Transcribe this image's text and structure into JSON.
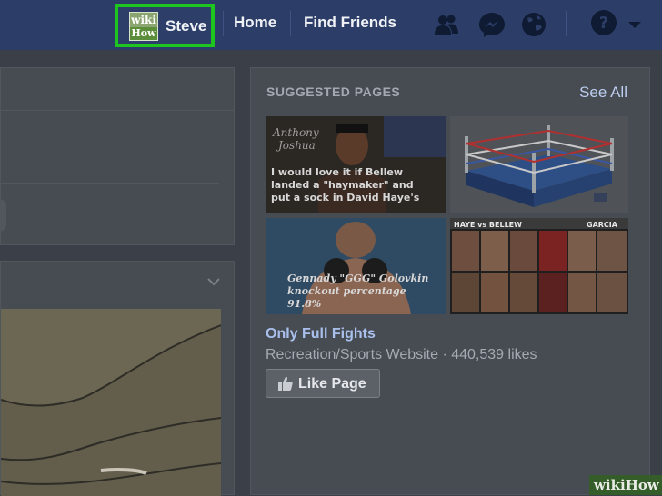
{
  "topbar": {
    "avatar_top": "wiki",
    "avatar_bottom": "How",
    "profile_name": "Steve",
    "home_label": "Home",
    "find_friends_label": "Find Friends"
  },
  "suggested": {
    "title": "SUGGESTED PAGES",
    "see_all": "See All",
    "thumb1_caption": "I would love it if Bellew landed a \"haymaker\" and put a sock in David Haye's",
    "thumb3_caption": "Gennady \"GGG\" Golovkin knockout percentage 91.8%",
    "page_name": "Only Full Fights",
    "page_meta": "Recreation/Sports Website · 440,539 likes",
    "like_label": "Like Page"
  },
  "watermark": "wikiHow",
  "colors": {
    "topbar": "#2c3e67",
    "highlight": "#1ec51e",
    "link": "#a9c0ed",
    "panel": "#474b52"
  },
  "icons": [
    "friends-icon",
    "messenger-icon",
    "globe-icon",
    "help-icon",
    "dropdown-arrow-icon",
    "chevron-down-icon",
    "thumbs-up-icon"
  ]
}
